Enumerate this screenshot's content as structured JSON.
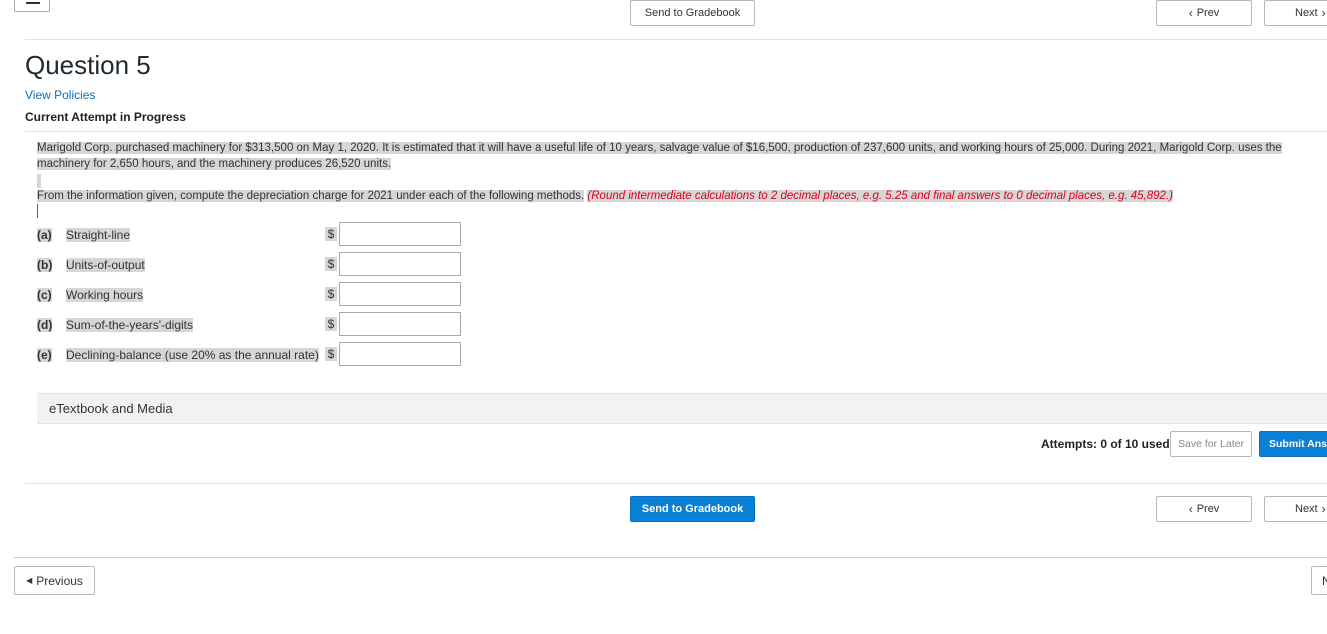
{
  "header": {
    "send_gradebook": "Send to Gradebook",
    "prev": "Prev",
    "next": "Next"
  },
  "question": {
    "title": "Question 5",
    "view_policies": "View Policies",
    "attempt_status": "Current Attempt in Progress",
    "prompt_line1": "Marigold Corp. purchased machinery for $313,500 on May 1, 2020. It is estimated that it will have a useful life of 10 years, salvage value of $16,500, production of 237,600 units, and working hours of 25,000. During 2021, Marigold Corp. uses the",
    "prompt_line2": "machinery for 2,650 hours, and the machinery produces 26,520 units.",
    "instruction": "From the information given, compute the depreciation charge for 2021 under each of the following methods.",
    "hint": "(Round intermediate calculations to 2 decimal places, e.g. 5.25 and final answers to 0 decimal places, e.g. 45,892.)",
    "rows": [
      {
        "letter": "(a)",
        "label": "Straight-line",
        "currency": "$",
        "value": ""
      },
      {
        "letter": "(b)",
        "label": "Units-of-output",
        "currency": "$",
        "value": ""
      },
      {
        "letter": "(c)",
        "label": "Working hours",
        "currency": "$",
        "value": ""
      },
      {
        "letter": "(d)",
        "label": "Sum-of-the-years'-digits",
        "currency": "$",
        "value": ""
      },
      {
        "letter": "(e)",
        "label": "Declining-balance (use 20% as the annual rate)",
        "currency": "$",
        "value": ""
      }
    ]
  },
  "etextbook": {
    "label": "eTextbook and Media"
  },
  "footer_actions": {
    "attempts": "Attempts: 0 of 10 used",
    "save_later": "Save for Later",
    "submit": "Submit Answ"
  },
  "bottom": {
    "send_gradebook": "Send to Gradebook",
    "prev": "Prev",
    "next": "Next",
    "previous": "Previous",
    "next_partial": "N"
  },
  "colors": {
    "accent": "#0a7fd6",
    "hint": "#e0001b",
    "link": "#0a6fbd",
    "selection": "#d6d6d6"
  }
}
